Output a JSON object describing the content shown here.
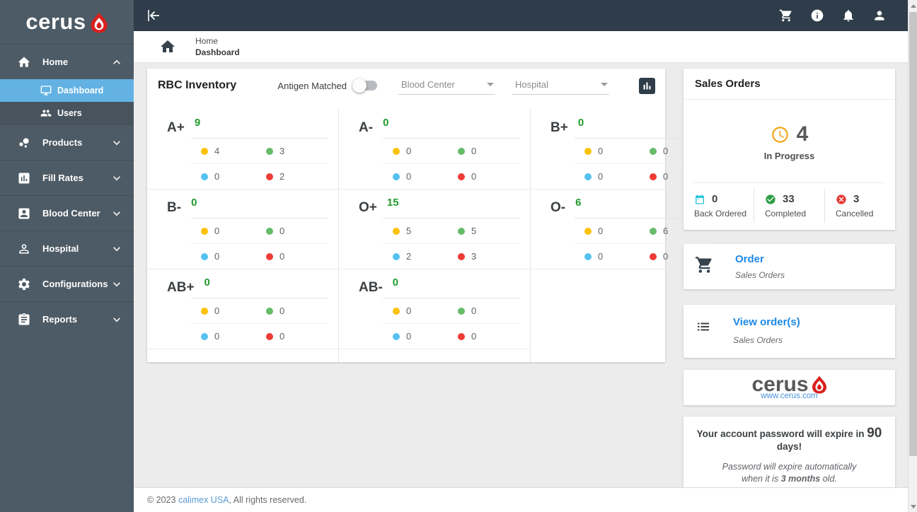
{
  "brand": {
    "name": "cerus",
    "website": "www.cerus.com"
  },
  "topbar": {
    "icons": [
      {
        "name": "cart"
      },
      {
        "name": "info"
      },
      {
        "name": "bell"
      },
      {
        "name": "person"
      }
    ]
  },
  "breadcrumb": {
    "section": "Home",
    "page": "Dashboard"
  },
  "sidebar": {
    "items": [
      {
        "label": "Home",
        "icon": "home",
        "chevron": "up",
        "active": true,
        "children": [
          {
            "label": "Dashboard",
            "icon": "dashboard",
            "active": true
          },
          {
            "label": "Users",
            "icon": "users",
            "active": false
          }
        ]
      },
      {
        "label": "Products",
        "icon": "products",
        "chevron": "down"
      },
      {
        "label": "Fill Rates",
        "icon": "fill-rates",
        "chevron": "down"
      },
      {
        "label": "Blood Center",
        "icon": "blood-center",
        "chevron": "down"
      },
      {
        "label": "Hospital",
        "icon": "hospital",
        "chevron": "down"
      },
      {
        "label": "Configurations",
        "icon": "configurations",
        "chevron": "down"
      },
      {
        "label": "Reports",
        "icon": "reports",
        "chevron": "down"
      }
    ]
  },
  "rbc_inventory": {
    "title": "RBC Inventory",
    "toggle_label": "Antigen Matched",
    "toggle_on": false,
    "filters": [
      {
        "label": "Blood Center"
      },
      {
        "label": "Hospital"
      }
    ],
    "columns": [
      [
        {
          "type": "A+",
          "total": "9",
          "counts": {
            "yellow": "4",
            "green": "3",
            "blue": "0",
            "red": "2"
          }
        },
        {
          "type": "B-",
          "total": "0",
          "counts": {
            "yellow": "0",
            "green": "0",
            "blue": "0",
            "red": "0"
          }
        },
        {
          "type": "AB+",
          "total": "0",
          "counts": {
            "yellow": "0",
            "green": "0",
            "blue": "0",
            "red": "0"
          }
        }
      ],
      [
        {
          "type": "A-",
          "total": "0",
          "counts": {
            "yellow": "0",
            "green": "0",
            "blue": "0",
            "red": "0"
          }
        },
        {
          "type": "O+",
          "total": "15",
          "counts": {
            "yellow": "5",
            "green": "5",
            "blue": "2",
            "red": "3"
          }
        },
        {
          "type": "AB-",
          "total": "0",
          "counts": {
            "yellow": "0",
            "green": "0",
            "blue": "0",
            "red": "0"
          }
        }
      ],
      [
        {
          "type": "B+",
          "total": "0",
          "counts": {
            "yellow": "0",
            "green": "0",
            "blue": "0",
            "red": "0"
          }
        },
        {
          "type": "O-",
          "total": "6",
          "counts": {
            "yellow": "0",
            "green": "6",
            "blue": "0",
            "red": "0"
          }
        }
      ]
    ]
  },
  "sales_orders": {
    "title": "Sales Orders",
    "in_progress": {
      "value": "4",
      "label": "In Progress"
    },
    "stats": [
      {
        "icon": "calendar",
        "value": "0",
        "label": "Back Ordered",
        "color": "#26c6da"
      },
      {
        "icon": "check-circle",
        "value": "33",
        "label": "Completed",
        "color": "#2e9e44"
      },
      {
        "icon": "cancel-circle",
        "value": "3",
        "label": "Cancelled",
        "color": "#e53935"
      }
    ]
  },
  "shortcuts": [
    {
      "icon": "cart",
      "title": "Order",
      "subtitle": "Sales Orders"
    },
    {
      "icon": "list",
      "title": "View order(s)",
      "subtitle": "Sales Orders"
    }
  ],
  "password_notice": {
    "line1_prefix": "Your account password will expire in ",
    "line1_days": "90",
    "line1_suffix": " days!",
    "line2": "Password will expire automatically",
    "line3_prefix": "when it is ",
    "line3_bold": "3 months",
    "line3_suffix": " old."
  },
  "footer": {
    "prefix": "© 2023 ",
    "link": "calimex USA",
    "suffix": ", All rights reserved."
  },
  "colors": {
    "yellow": "#fdc107",
    "green": "#66bb6a",
    "blue": "#54c2f0",
    "red": "#ef3b36",
    "total_green": "#219a2b",
    "accent_blue": "#1e88e5",
    "sidebar": "#4d5b66",
    "topbar": "#2e3d49",
    "active_item": "#64b2e4"
  }
}
